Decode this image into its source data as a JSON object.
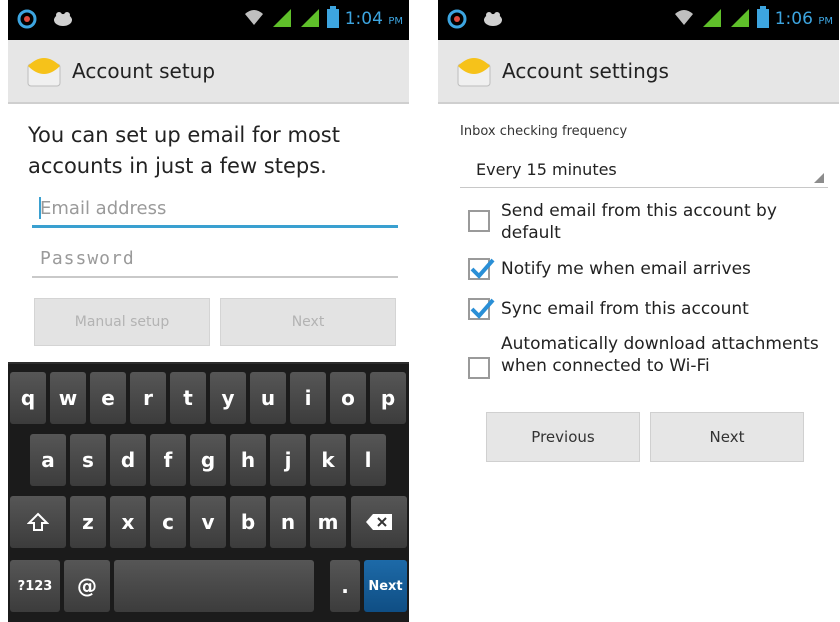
{
  "left_screen": {
    "status_bar": {
      "time": "1:04",
      "ampm": "PM"
    },
    "title": "Account setup",
    "intro": "You can set up email for most accounts in just a few steps.",
    "email_placeholder": "Email address",
    "password_placeholder": "Password",
    "manual_setup_label": "Manual setup",
    "next_label": "Next",
    "keyboard": {
      "row1": [
        "q",
        "w",
        "e",
        "r",
        "t",
        "y",
        "u",
        "i",
        "o",
        "p"
      ],
      "row2": [
        "a",
        "s",
        "d",
        "f",
        "g",
        "h",
        "j",
        "k",
        "l"
      ],
      "row3": [
        "z",
        "x",
        "c",
        "v",
        "b",
        "n",
        "m"
      ],
      "symbols_label": "?123",
      "at_label": "@",
      "period_label": ".",
      "next_label": "Next"
    }
  },
  "right_screen": {
    "status_bar": {
      "time": "1:06",
      "ampm": "PM"
    },
    "title": "Account settings",
    "frequency_label": "Inbox checking frequency",
    "frequency_value": "Every 15 minutes",
    "options": [
      {
        "label": "Send email from this account by default",
        "checked": false
      },
      {
        "label": "Notify me when email arrives",
        "checked": true
      },
      {
        "label": "Sync email from this account",
        "checked": true
      },
      {
        "label": "Automatically download attachments when connected to Wi-Fi",
        "checked": false
      }
    ],
    "previous_label": "Previous",
    "next_label": "Next"
  },
  "colors": {
    "status_icon": "#3da5e0",
    "accent": "#3aa0d0",
    "checkmark": "#2a8fd6",
    "keyboard_next": "#0f4e84"
  },
  "icons": {
    "status_left": [
      "android-icon",
      "notification-icon"
    ],
    "status_right": [
      "wifi-icon",
      "signal-icon",
      "signal-icon-2",
      "battery-icon"
    ],
    "app": "email-envelope-icon",
    "shift": "shift-icon",
    "backspace": "backspace-icon"
  }
}
